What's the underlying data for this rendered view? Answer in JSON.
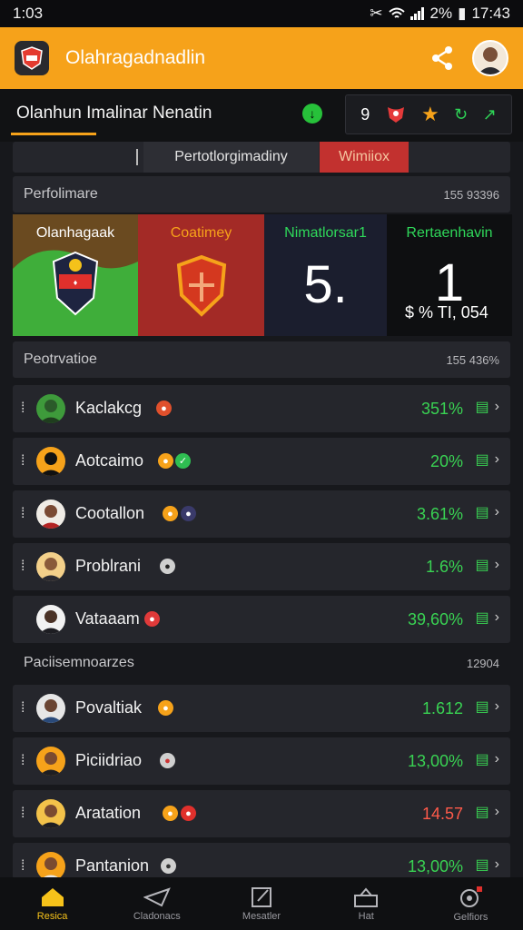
{
  "status_bar": {
    "time": "1:03",
    "battery": "2%",
    "clock": "17:43"
  },
  "app_bar": {
    "title": "Olahragadnadlin"
  },
  "sub_nav": {
    "title": "Olanhun Imalinar Nenatin",
    "actions_text": "9"
  },
  "segments": {
    "tab_a": "Pertotlorgimadiny",
    "tab_b": "Wimiiox"
  },
  "performance": {
    "title": "Perfolimare",
    "count": "155 93396"
  },
  "tiles": [
    {
      "header": "Olanhagaak"
    },
    {
      "header": "Coatimey"
    },
    {
      "header": "Nimatlorsar1",
      "value": "5."
    },
    {
      "header": "Rertaenhavin",
      "value": "1",
      "sub": "$ % TI, 054"
    }
  ],
  "section_a": {
    "title": "Peotrvatioe",
    "count": "155 436%"
  },
  "list_a": [
    {
      "name": "Kaclakcg",
      "value": "351%",
      "value_color": "#39d353"
    },
    {
      "name": "Aotcaimo",
      "value": "20%",
      "value_color": "#39d353"
    },
    {
      "name": "Cootallon",
      "value": "3.61%",
      "value_color": "#39d353"
    },
    {
      "name": "Problrani",
      "value": "1.6%",
      "value_color": "#39d353"
    },
    {
      "name": "Vataaam",
      "value": "39,60%",
      "value_color": "#39d353"
    }
  ],
  "section_b": {
    "title": "Paciisemnoarzes",
    "count": "12904"
  },
  "list_b": [
    {
      "name": "Povaltiak",
      "value": "1.612",
      "value_color": "#39d353"
    },
    {
      "name": "Piciidriao",
      "value": "13,00%",
      "value_color": "#39d353"
    },
    {
      "name": "Aratation",
      "value": "14.57",
      "value_color": "#ff5a4a"
    },
    {
      "name": "Pantanion",
      "value": "13,00%",
      "value_color": "#39d353"
    }
  ],
  "bottom_nav": [
    {
      "label": "Resica",
      "icon": "home-icon"
    },
    {
      "label": "Cladonacs",
      "icon": "send-icon"
    },
    {
      "label": "Mesatler",
      "icon": "note-icon"
    },
    {
      "label": "Hat",
      "icon": "bag-icon"
    },
    {
      "label": "Gelfiors",
      "icon": "settings-icon"
    }
  ],
  "colors": {
    "accent": "#f6a21a",
    "positive": "#39d353",
    "negative": "#ff5a4a"
  }
}
